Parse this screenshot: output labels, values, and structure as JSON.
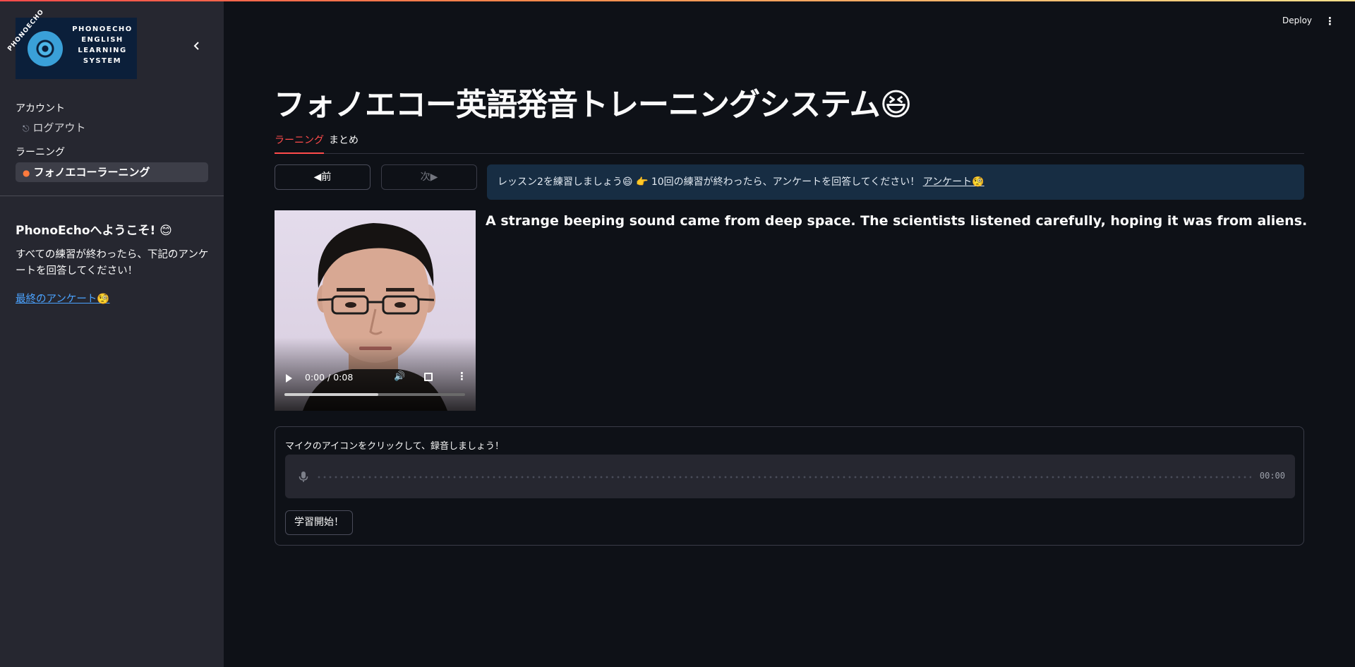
{
  "sidebar": {
    "logo": {
      "arc_text": "PHONOECHO",
      "text": "PHONOECHO ENGLISH LEARNING SYSTEM"
    },
    "sections": [
      {
        "heading": "アカウント",
        "items": [
          {
            "label": "ログアウト",
            "icon": "logout-icon",
            "active": false
          }
        ]
      },
      {
        "heading": "ラーニング",
        "items": [
          {
            "label": "フォノエコーラーニング",
            "icon": "fire-icon",
            "active": true
          }
        ]
      }
    ],
    "welcome": "PhonoEchoへようこそ! 😊",
    "text": "すべての練習が終わったら、下記のアンケートを回答してください！",
    "link": "最終のアンケート🧐"
  },
  "header": {
    "deploy": "Deploy",
    "menu_icon": "kebab-menu-icon"
  },
  "main": {
    "title": "フォノエコー英語発音トレーニングシステム😆",
    "tabs": [
      {
        "label": "ラーニング",
        "active": true
      },
      {
        "label": "まとめ",
        "active": false
      }
    ],
    "prev": "◀前",
    "next": "次▶",
    "info": {
      "text": "レッスン2を練習しましょう😄 👉 10回の練習が終わったら、アンケートを回答してください！",
      "link": "アンケート🧐"
    },
    "video": {
      "time": "0:00 / 0:08",
      "progress": 0.52
    },
    "sentence": "A strange beeping sound came from deep space. The scientists listened carefully, hoping it was from aliens.",
    "recorder": {
      "label": "マイクのアイコンをクリックして、録音しましょう！",
      "time": "00:00",
      "button": "学習開始！"
    }
  },
  "colors": {
    "accent": "#ff4b4b",
    "info_bg": "#172d43",
    "link": "#4ba3ff"
  }
}
